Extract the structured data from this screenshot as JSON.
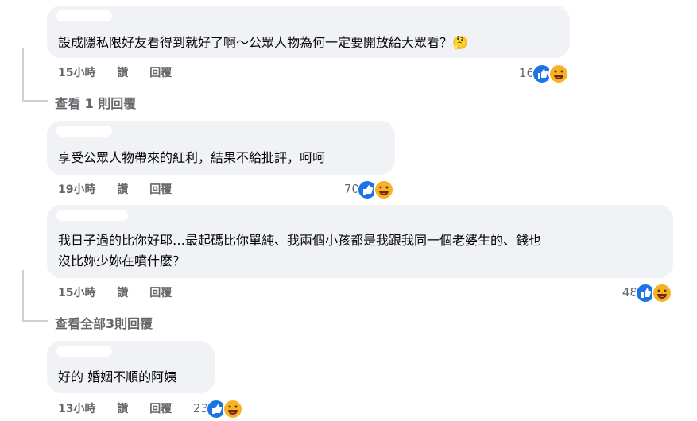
{
  "comments": [
    {
      "text": "設成隱私限好友看得到就好了啊～公眾人物為何一定要開放給大眾看？🤔",
      "time": "15小時",
      "like_label": "讚",
      "reply_label": "回覆",
      "reaction_count": "16",
      "reactions": [
        "like-icon",
        "haha-icon"
      ]
    },
    {
      "text": "享受公眾人物帶來的紅利，結果不給批評，呵呵",
      "time": "19小時",
      "like_label": "讚",
      "reply_label": "回覆",
      "reaction_count": "70",
      "reactions": [
        "like-icon",
        "haha-icon"
      ]
    },
    {
      "text_line1": "我日子過的比你好耶…最起碼比你單純、我兩個小孩都是我跟我同一個老婆生的、錢也",
      "text_line2": "沒比妳少妳在噴什麼？",
      "time": "15小時",
      "like_label": "讚",
      "reply_label": "回覆",
      "reaction_count": "48",
      "reactions": [
        "like-icon",
        "haha-icon"
      ]
    },
    {
      "text": "好的 婚姻不順的阿姨",
      "time": "13小時",
      "like_label": "讚",
      "reply_label": "回覆",
      "reaction_count": "23",
      "reactions": [
        "like-icon",
        "haha-icon"
      ]
    }
  ],
  "view_replies": [
    {
      "label": "查看 1 則回覆"
    },
    {
      "label": "查看全部3則回覆"
    }
  ],
  "colors": {
    "bubble": "#f0f2f5",
    "meta": "#65676b",
    "like": "#1b74e4",
    "haha": "#f7b125"
  }
}
